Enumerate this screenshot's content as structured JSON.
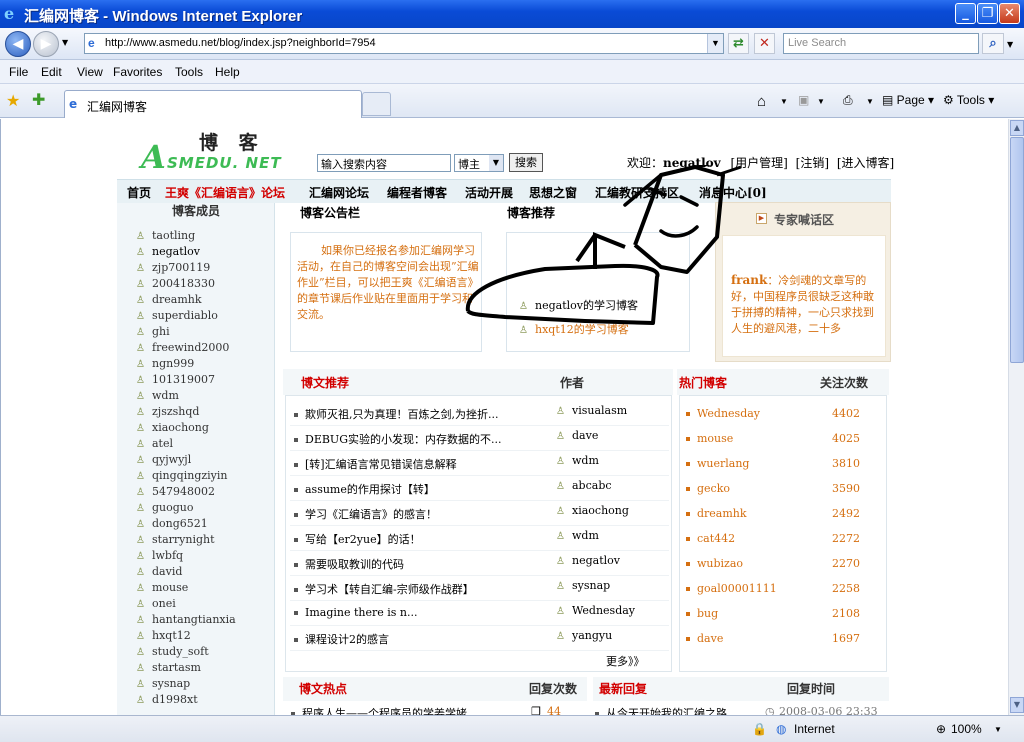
{
  "window": {
    "title": "汇编网博客 - Windows Internet Explorer"
  },
  "browser": {
    "url": "http://www.asmedu.net/blog/index.jsp?neighborId=7954",
    "search_placeholder": "Live Search",
    "menu": [
      "File",
      "Edit",
      "View",
      "Favorites",
      "Tools",
      "Help"
    ],
    "tab_title": "汇编网博客",
    "tools": {
      "page": "Page",
      "tools": "Tools"
    },
    "status": {
      "zone": "Internet",
      "zoom": "100%"
    }
  },
  "site": {
    "logo_cn": "博 客",
    "logo_a": "A",
    "logo_en": "SMEDU. NET",
    "search_value": "输入搜索内容",
    "search_scope": "博主",
    "search_button": "搜索",
    "welcome_prefix": "欢迎：",
    "username": "negatlov",
    "welcome_links": [
      "[用户管理]",
      "[注销]",
      "[进入博客]"
    ],
    "nav": [
      "首页",
      "王爽《汇编语言》论坛",
      "汇编网论坛",
      "编程者博客",
      "活动开展",
      "思想之窗",
      "汇编教研支持区",
      "消息中心[0]"
    ],
    "members_title": "博客成员",
    "members": [
      "taotling",
      "negatlov",
      "zjp700119",
      "200418330",
      "dreamhk",
      "superdiablo",
      "ghi",
      "freewind2000",
      "ngn999",
      "101319007",
      "wdm",
      "zjszshqd",
      "xiaochong",
      "atel",
      "qyjwyjl",
      "qingqingziyin",
      "547948002",
      "guoguo",
      "dong6521",
      "starrynight",
      "lwbfq",
      "david",
      "mouse",
      "onei",
      "hantangtianxia",
      "hxqt12",
      "study_soft",
      "startasm",
      "sysnap",
      "d1998xt"
    ],
    "notice": {
      "title": "博客公告栏",
      "text": "如果你已经报名参加汇编网学习活动，在自己的博客空间会出现”汇编作业”栏目，可以把王爽《汇编语言》的章节课后作业贴在里面用于学习和交流。"
    },
    "recommend": {
      "title": "博客推荐",
      "items": [
        "negatlov的学习博客",
        "hxqt12的学习博客"
      ]
    },
    "expert": {
      "title": "专家喊话区",
      "author": "frank",
      "text": "：冷剑魂的文章写的好，中国程序员很缺乏这种敢于拼搏的精神，一心只求找到人生的避风港，二十多"
    },
    "posts": {
      "title": "博文推荐",
      "author_header": "作者",
      "more": "更多》》",
      "items": [
        {
          "title": "欺师灭祖,只为真理！百炼之剑,为挫折...",
          "author": "visualasm"
        },
        {
          "title": "DEBUG实验的小发现：内存数据的不...",
          "author": "dave"
        },
        {
          "title": "[转]汇编语言常见错误信息解释",
          "author": "wdm"
        },
        {
          "title": "assume的作用探讨【转】",
          "author": "abcabc"
        },
        {
          "title": "学习《汇编语言》的感言！",
          "author": "xiaochong"
        },
        {
          "title": "写给【er2yue】的话！",
          "author": "wdm"
        },
        {
          "title": "需要吸取教训的代码",
          "author": "negatlov"
        },
        {
          "title": "学习术【转自汇编-宗师级作战群】",
          "author": "sysnap"
        },
        {
          "title": "Imagine there is n...",
          "author": "Wednesday"
        },
        {
          "title": "课程设计2的感言",
          "author": "yangyu"
        }
      ]
    },
    "hot_blogs": {
      "title": "热门博客",
      "count_header": "关注次数",
      "items": [
        {
          "name": "Wednesday",
          "count": "4402"
        },
        {
          "name": "mouse",
          "count": "4025"
        },
        {
          "name": "wuerlang",
          "count": "3810"
        },
        {
          "name": "gecko",
          "count": "3590"
        },
        {
          "name": "dreamhk",
          "count": "2492"
        },
        {
          "name": "cat442",
          "count": "2272"
        },
        {
          "name": "wubizao",
          "count": "2270"
        },
        {
          "name": "goal00001111",
          "count": "2258"
        },
        {
          "name": "bug",
          "count": "2108"
        },
        {
          "name": "dave",
          "count": "1697"
        }
      ]
    },
    "hot_posts": {
      "title": "博文热点",
      "reply_header": "回复次数",
      "first_row": "程序人生——个程序员的学姜学姥",
      "first_count": "44"
    },
    "latest_replies": {
      "title": "最新回复",
      "time_header": "回复时间",
      "first_row": "从今天开始我的汇编之路",
      "first_time": "2008-03-06 23:33"
    }
  },
  "colors": {
    "titlebar": "#0a4bd6",
    "accent_red": "#d20000",
    "accent_orange": "#d56f10",
    "logo_green": "#3dbb54"
  }
}
